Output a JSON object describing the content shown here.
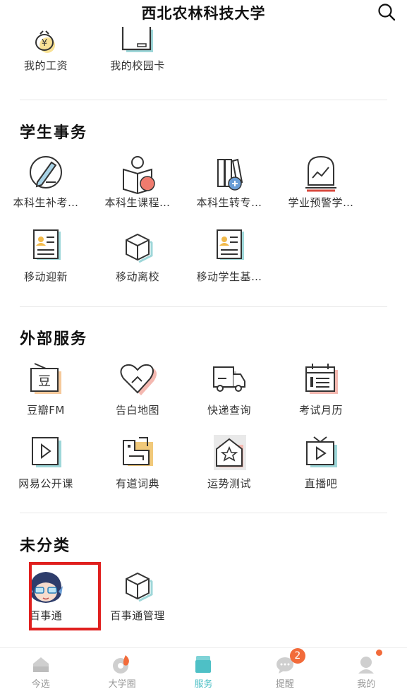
{
  "header": {
    "title": "西北农林科技大学"
  },
  "top_items": [
    {
      "label": "我的工资",
      "icon": "wage-icon"
    },
    {
      "label": "我的校园卡",
      "icon": "campus-card-icon"
    }
  ],
  "sections": [
    {
      "title": "学生事务",
      "rows": [
        [
          {
            "label": "本科生补考…",
            "icon": "pencil-icon"
          },
          {
            "label": "本科生课程…",
            "icon": "reading-icon"
          },
          {
            "label": "本科生转专…",
            "icon": "books-transfer-icon"
          },
          {
            "label": "学业预警学…",
            "icon": "warning-chart-icon"
          }
        ],
        [
          {
            "label": "移动迎新",
            "icon": "profile-card-icon"
          },
          {
            "label": "移动离校",
            "icon": "box-icon"
          },
          {
            "label": "移动学生基…",
            "icon": "profile-card-icon"
          }
        ]
      ]
    },
    {
      "title": "外部服务",
      "rows": [
        [
          {
            "label": "豆瓣FM",
            "icon": "radio-icon"
          },
          {
            "label": "告白地图",
            "icon": "heart-icon"
          },
          {
            "label": "快递查询",
            "icon": "truck-icon"
          },
          {
            "label": "考试月历",
            "icon": "calendar-icon"
          }
        ],
        [
          {
            "label": "网易公开课",
            "icon": "video-icon"
          },
          {
            "label": "有道词典",
            "icon": "dictionary-icon"
          },
          {
            "label": "运势测试",
            "icon": "star-house-icon"
          },
          {
            "label": "直播吧",
            "icon": "tv-icon"
          }
        ]
      ]
    },
    {
      "title": "未分类",
      "rows": [
        [
          {
            "label": "百事通",
            "icon": "avatar-icon"
          },
          {
            "label": "百事通管理",
            "icon": "box-icon"
          }
        ]
      ]
    }
  ],
  "tabbar": {
    "tabs": [
      {
        "label": "今选",
        "icon": "home-icon"
      },
      {
        "label": "大学圈",
        "icon": "fire-circle-icon"
      },
      {
        "label": "服务",
        "icon": "services-icon",
        "active": true
      },
      {
        "label": "提醒",
        "icon": "chat-icon",
        "badge": "2"
      },
      {
        "label": "我的",
        "icon": "user-icon",
        "dot": true
      }
    ]
  },
  "colors": {
    "accent": "#4ec0c6",
    "badge": "#f26b3a",
    "highlight": "#e0201f"
  }
}
